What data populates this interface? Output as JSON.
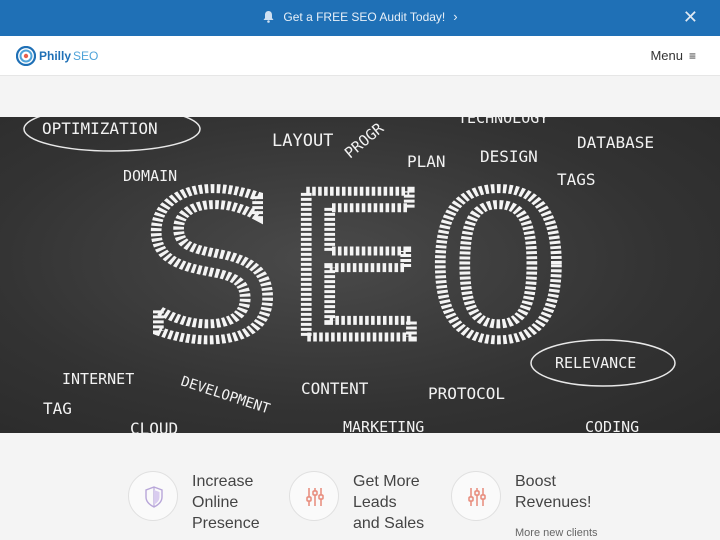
{
  "topbar": {
    "promo_text": "Get a FREE SEO Audit Today!",
    "chevron": "›",
    "close": "✕",
    "bg_color": "#1f70b6"
  },
  "nav": {
    "logo_name": "Philly",
    "logo_suffix": "SEO",
    "menu_label": "Menu",
    "menu_icon": "≡"
  },
  "hero": {
    "center_word": "SEO",
    "words": [
      "OPTIMIZATION",
      "LAYOUT",
      "PROGR",
      "TECHNOLOGY",
      "DATABASE",
      "DOMAIN",
      "PLAN",
      "DESIGN",
      "TAGS",
      "RELEVANCE",
      "INTERNET",
      "DEVELOPMENT",
      "CONTENT",
      "PROTOCOL",
      "TAG",
      "CLOUD",
      "MARKETING",
      "CODING"
    ]
  },
  "features": [
    {
      "title_lines": [
        "Increase",
        "Online",
        "Presence"
      ],
      "icon": "shield-icon"
    },
    {
      "title_lines": [
        "Get More",
        "Leads",
        "and Sales"
      ],
      "icon": "sliders-icon"
    },
    {
      "title_lines": [
        "Boost",
        "Revenues!"
      ],
      "sub": "More new clients",
      "icon": "sliders-icon"
    }
  ]
}
